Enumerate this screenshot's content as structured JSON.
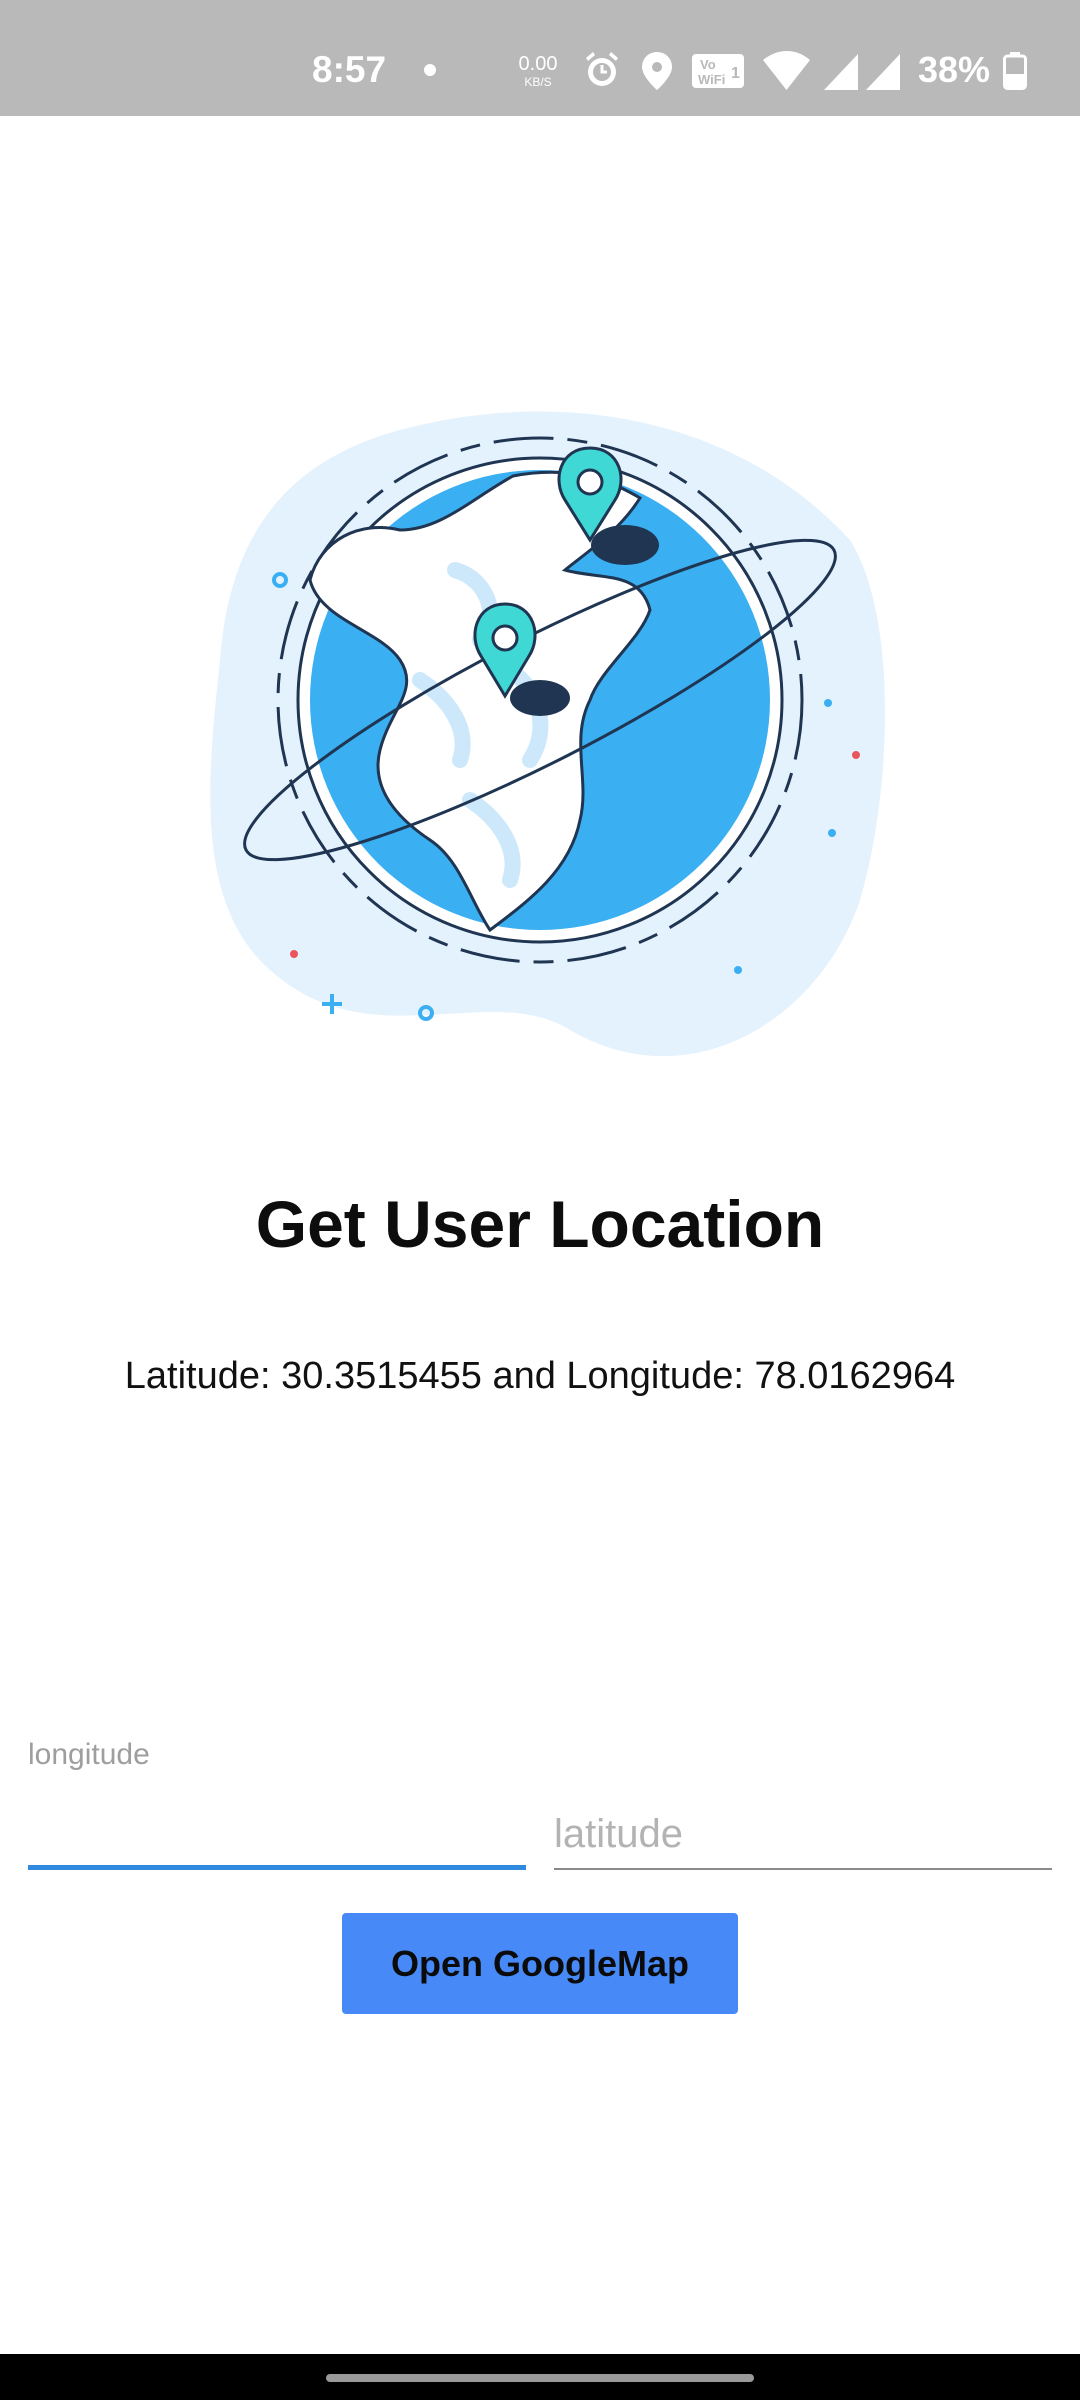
{
  "status_bar": {
    "time": "8:57",
    "net_speed_value": "0.00",
    "net_speed_unit": "KB/S",
    "battery_percent": "38%",
    "icons": [
      "dot-icon",
      "alarm-icon",
      "location-icon",
      "vowifi-icon",
      "wifi-icon",
      "signal-icon",
      "signal-icon",
      "battery-icon"
    ]
  },
  "hero": {
    "image": "globe-with-location-pins-illustration",
    "colors": {
      "ocean": "#3aaff2",
      "land": "#ffffff",
      "halo": "#e4f2fd",
      "pin": "#3fd8d4",
      "outline": "#1f3552"
    }
  },
  "title": "Get User Location",
  "coordinates_text": "Latitude: 30.3515455 and Longitude: 78.0162964",
  "form": {
    "longitude": {
      "label": "longitude",
      "value": ""
    },
    "latitude": {
      "placeholder": "latitude",
      "value": ""
    }
  },
  "button": {
    "label": "Open GoogleMap",
    "color": "#4689f7"
  },
  "accent_color": "#2f8ae0"
}
